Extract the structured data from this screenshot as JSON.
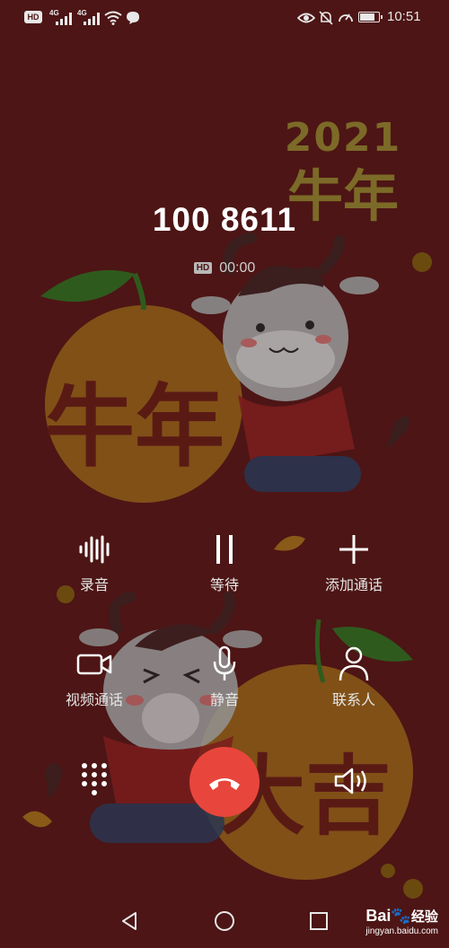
{
  "status_bar": {
    "hd_badge": "HD",
    "signal1_label": "4G",
    "signal2_label": "4G",
    "battery_level": 0.85,
    "time": "10:51"
  },
  "background": {
    "year": "2021",
    "headline": "牛年",
    "fruit_text_left": "牛年",
    "fruit_text_right": "大吉"
  },
  "call": {
    "number": "100 8611",
    "hd_badge": "HD",
    "duration": "00:00"
  },
  "actions": {
    "record": "录音",
    "hold": "等待",
    "add_call": "添加通话",
    "video_call": "视频通话",
    "mute": "静音",
    "contacts": "联系人"
  },
  "watermark": {
    "brand": "Bai",
    "brand_suffix": "经验",
    "url": "jingyan.baidu.com"
  },
  "colors": {
    "background": "#4d1515",
    "end_call": "#e8463c"
  }
}
